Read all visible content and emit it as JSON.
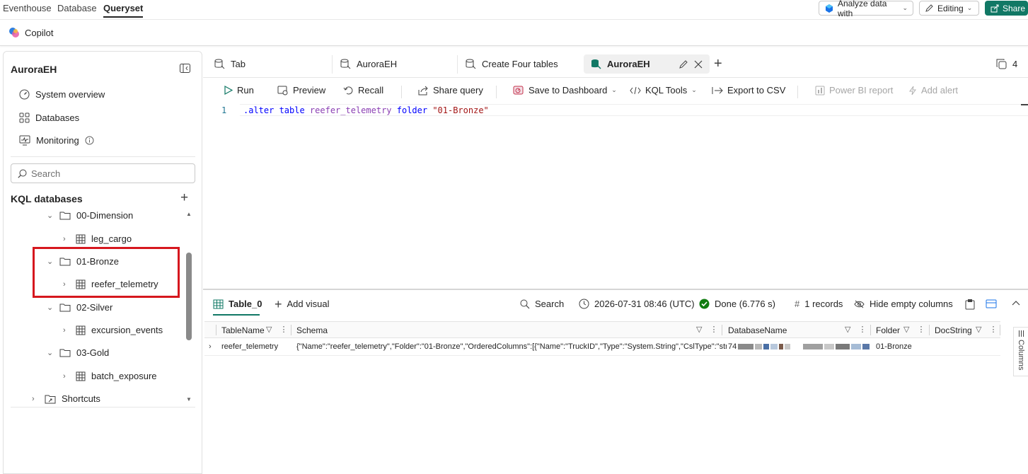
{
  "topnav": {
    "tabs": [
      "Eventhouse",
      "Database",
      "Queryset"
    ],
    "active_tab": "Queryset",
    "analyze_label": "Analyze data with",
    "editing_label": "Editing",
    "share_label": "Share"
  },
  "copilot": {
    "label": "Copilot"
  },
  "leftpane": {
    "title": "AuroraEH",
    "nav": [
      {
        "label": "System overview",
        "icon": "gauge-icon"
      },
      {
        "label": "Databases",
        "icon": "grid-icon"
      },
      {
        "label": "Monitoring",
        "icon": "monitor-icon"
      }
    ],
    "search_placeholder": "Search",
    "section_title": "KQL databases",
    "tree": [
      {
        "label": "00-Dimension",
        "kind": "folder",
        "expanded": true
      },
      {
        "label": "leg_cargo",
        "kind": "table"
      },
      {
        "label": "01-Bronze",
        "kind": "folder",
        "expanded": true
      },
      {
        "label": "reefer_telemetry",
        "kind": "table"
      },
      {
        "label": "02-Silver",
        "kind": "folder",
        "expanded": true
      },
      {
        "label": "excursion_events",
        "kind": "table"
      },
      {
        "label": "03-Gold",
        "kind": "folder",
        "expanded": true
      },
      {
        "label": "batch_exposure",
        "kind": "table"
      },
      {
        "label": "Shortcuts",
        "kind": "shortcut-folder",
        "expanded": false
      }
    ]
  },
  "query_tabs": {
    "tabs": [
      "Tab",
      "AuroraEH",
      "Create Four tables",
      "AuroraEH"
    ],
    "active_index": 3,
    "count": "4"
  },
  "toolbar": {
    "run": "Run",
    "preview": "Preview",
    "recall": "Recall",
    "share_query": "Share query",
    "save_dashboard": "Save to Dashboard",
    "kql_tools": "KQL Tools",
    "export_csv": "Export to CSV",
    "power_bi": "Power BI report",
    "add_alert": "Add alert"
  },
  "editor": {
    "line_number": "1",
    "tokens": {
      "cmd": ".alter table ",
      "table": "reefer_telemetry",
      "folder_kw": " folder ",
      "value": "\"01-Bronze\""
    }
  },
  "results": {
    "table_tab": "Table_0",
    "add_visual": "Add visual",
    "search": "Search",
    "timestamp": "2026-07-31 08:46 (UTC)",
    "status": "Done (6.776 s)",
    "records": "1 records",
    "hide_empty": "Hide empty columns",
    "columns_panel": "Columns",
    "columns": [
      "TableName",
      "Schema",
      "DatabaseName",
      "Folder",
      "DocString"
    ],
    "row": {
      "TableName": "reefer_telemetry",
      "Schema": "{\"Name\":\"reefer_telemetry\",\"Folder\":\"01-Bronze\",\"OrderedColumns\":[{\"Name\":\"TruckID\",\"Type\":\"System.String\",\"CslType\":\"string",
      "DatabaseName": "74",
      "Folder": "01-Bronze",
      "DocString": ""
    }
  },
  "colors": {
    "accent_green": "#117865",
    "highlight_red": "#d6171e",
    "status_green": "#107c10"
  }
}
